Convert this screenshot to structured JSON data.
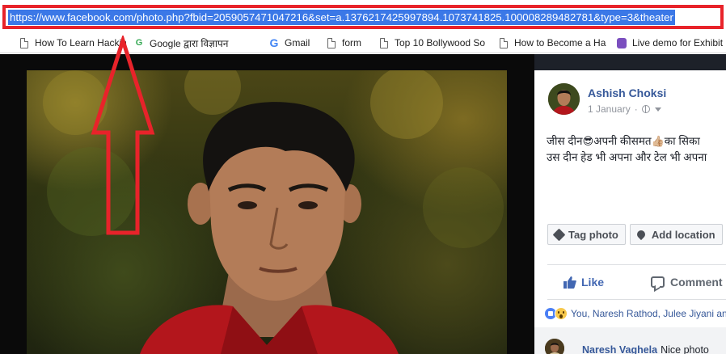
{
  "browser": {
    "url": "https://www.facebook.com/photo.php?fbid=2059057471047216&set=a.1376217425997894.1073741825.100008289482781&type=3&theater"
  },
  "bookmarks": [
    {
      "label": "How To Learn Hackin",
      "icon": "document-icon"
    },
    {
      "label": "Google द्वारा विज्ञापन",
      "icon": "google-web-icon"
    },
    {
      "label": "Gmail",
      "icon": "google-icon"
    },
    {
      "label": "form",
      "icon": "document-icon"
    },
    {
      "label": "Top 10 Bollywood So",
      "icon": "document-icon"
    },
    {
      "label": "How to Become a Ha",
      "icon": "document-icon"
    },
    {
      "label": "Live demo for Exhibit",
      "icon": "purple-app-icon"
    }
  ],
  "post": {
    "author": "Ashish Choksi",
    "date": "1 January",
    "separator": "·",
    "caption_line1_a": "जीस दीन",
    "caption_emoji1": "😎",
    "caption_line1_b": "अपनी कीसमत",
    "caption_emoji2": "👍🏼",
    "caption_line1_c": "का सिका",
    "caption_line2": "उस दीन हेड भी अपना और टेल भी अपना"
  },
  "photo_actions": {
    "tag_photo": "Tag photo",
    "add_location": "Add location"
  },
  "post_actions": {
    "like": "Like",
    "comment": "Comment"
  },
  "reactions": {
    "summary": "You, Naresh Rathod, Julee Jiyani and"
  },
  "first_comment": {
    "name": "Naresh Vaghela",
    "text": "Nice photo"
  },
  "colors": {
    "annotation_red": "#e8232a",
    "url_selection": "#3b78e7",
    "facebook_blue": "#4267b2",
    "link_blue": "#365899"
  }
}
